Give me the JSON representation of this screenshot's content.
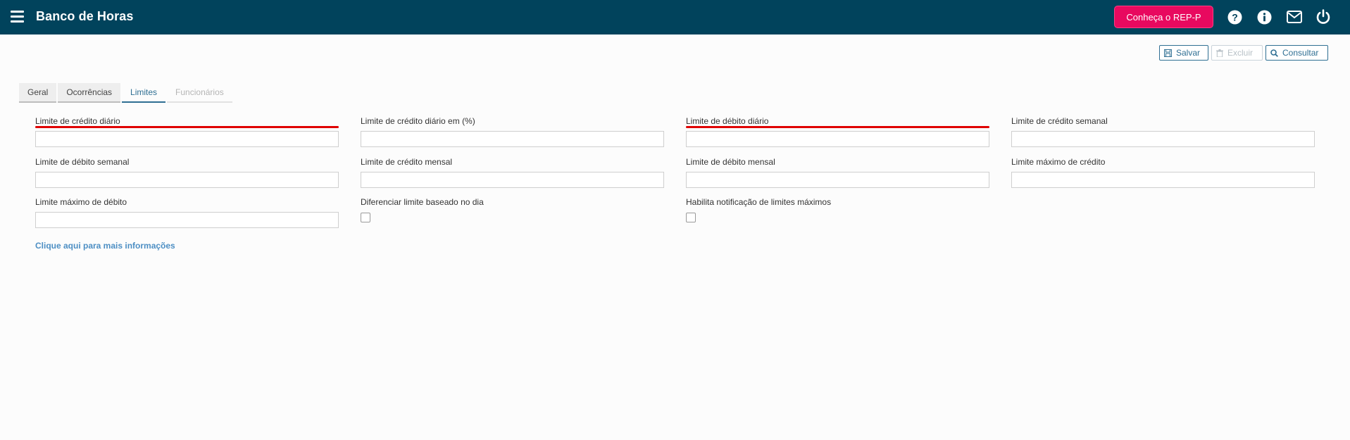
{
  "header": {
    "title": "Banco de Horas",
    "rep_button": "Conheça o REP-P",
    "icons": [
      "help-icon",
      "info-icon",
      "mail-icon",
      "power-icon"
    ]
  },
  "toolbar": {
    "save": "Salvar",
    "delete": "Excluir",
    "query": "Consultar"
  },
  "tabs": [
    {
      "label": "Geral",
      "state": "normal"
    },
    {
      "label": "Ocorrências",
      "state": "normal"
    },
    {
      "label": "Limites",
      "state": "active"
    },
    {
      "label": "Funcionários",
      "state": "disabled"
    }
  ],
  "fields": {
    "credito_diario": {
      "label": "Limite de crédito diário",
      "value": ""
    },
    "credito_diario_pct": {
      "label": "Limite de crédito diário em (%)",
      "value": ""
    },
    "debito_diario": {
      "label": "Limite de débito diário",
      "value": ""
    },
    "credito_semanal": {
      "label": "Limite de crédito semanal",
      "value": ""
    },
    "debito_semanal": {
      "label": "Limite de débito semanal",
      "value": ""
    },
    "credito_mensal": {
      "label": "Limite de crédito mensal",
      "value": ""
    },
    "debito_mensal": {
      "label": "Limite de débito mensal",
      "value": ""
    },
    "maximo_credito": {
      "label": "Limite máximo de crédito",
      "value": ""
    },
    "maximo_debito": {
      "label": "Limite máximo de débito",
      "value": ""
    },
    "diferenciar_dia": {
      "label": "Diferenciar limite baseado no dia",
      "checked": false
    },
    "notificacao_maximos": {
      "label": "Habilita notificação de limites máximos",
      "checked": false
    }
  },
  "info_link": "Clique aqui para mais informações",
  "colors": {
    "header_bg": "#01435c",
    "accent_pink": "#e8095f",
    "primary": "#2f6f93",
    "highlight_red": "#e00000",
    "link": "#4d8fc4"
  }
}
